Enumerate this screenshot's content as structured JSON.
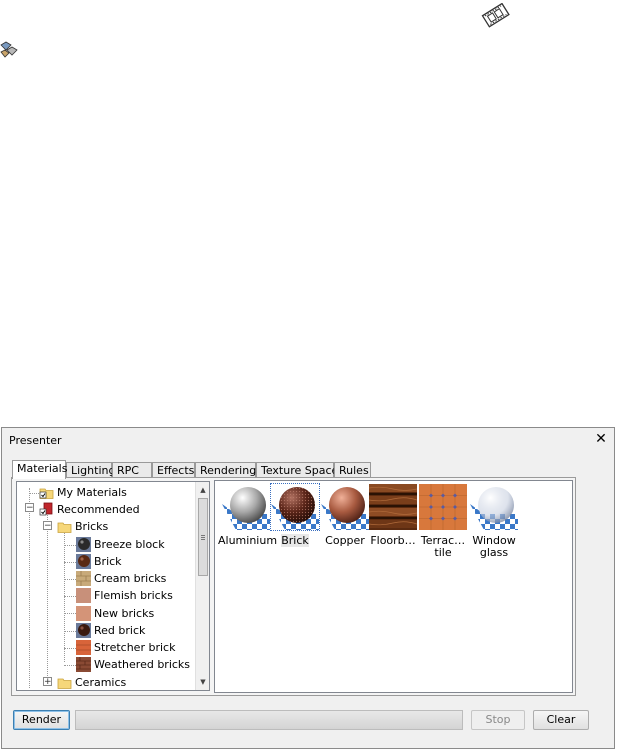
{
  "colors": {
    "accent": "#3c7fb1",
    "dialog_bg": "#f0f0f0",
    "panel_border": "#828790"
  },
  "dialog": {
    "title": "Presenter",
    "close_glyph": "✕",
    "tabs": [
      {
        "label": "Materials",
        "active": true
      },
      {
        "label": "Lighting"
      },
      {
        "label": "RPC"
      },
      {
        "label": "Effects"
      },
      {
        "label": "Rendering"
      },
      {
        "label": "Texture Space"
      },
      {
        "label": "Rules"
      }
    ],
    "tree": [
      {
        "label": "My Materials",
        "icon": "folder-icon"
      },
      {
        "label": "Recommended",
        "icon": "recommended-library-icon"
      },
      {
        "label": "Bricks",
        "icon": "folder-open-icon"
      },
      {
        "label": "Breeze block",
        "icon": "sphere-swatch-icon"
      },
      {
        "label": "Brick",
        "icon": "sphere-swatch-icon"
      },
      {
        "label": "Cream bricks",
        "icon": "texture-swatch-icon"
      },
      {
        "label": "Flemish bricks",
        "icon": "texture-swatch-icon"
      },
      {
        "label": "New bricks",
        "icon": "texture-swatch-icon"
      },
      {
        "label": "Red brick",
        "icon": "sphere-swatch-icon"
      },
      {
        "label": "Stretcher brick",
        "icon": "texture-swatch-icon"
      },
      {
        "label": "Weathered bricks",
        "icon": "texture-swatch-icon"
      },
      {
        "label": "Ceramics",
        "icon": "folder-icon"
      }
    ],
    "materials": [
      {
        "label": "Aluminium"
      },
      {
        "label": "Brick",
        "selected": true
      },
      {
        "label": "Copper"
      },
      {
        "label": "Floorb…"
      },
      {
        "label": "Terrac… tile"
      },
      {
        "label": "Window glass"
      }
    ],
    "buttons": {
      "render": "Render",
      "stop": "Stop",
      "clear": "Clear"
    },
    "render_progress": 0
  }
}
